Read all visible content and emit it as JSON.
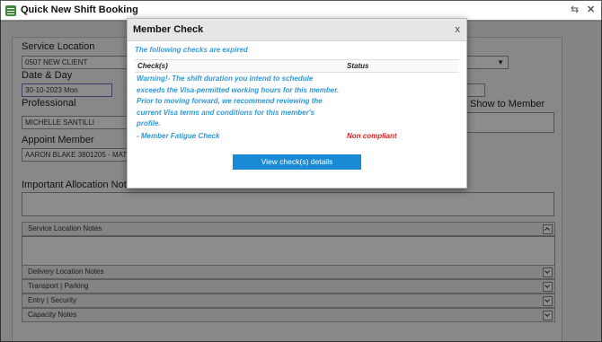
{
  "window": {
    "title": "Quick New Shift Booking"
  },
  "form": {
    "service_location": {
      "label": "Service Location",
      "value": "0507 NEW CLIENT"
    },
    "date_day": {
      "label": "Date & Day",
      "value": "30-10-2023 Mon"
    },
    "professional": {
      "label": "Professional",
      "value": "MICHELLE SANTILLI"
    },
    "show_to_member": {
      "label": "Show to Member"
    },
    "appoint_member": {
      "label": "Appoint Member",
      "value": "AARON BLAKE 3801205 - MATT:"
    },
    "important_notes": {
      "label": "Important Allocation Notes"
    },
    "sections": [
      {
        "label": "Service Location Notes"
      },
      {
        "label": "Delivery Location Notes"
      },
      {
        "label": "Transport | Parking"
      },
      {
        "label": "Entry | Security"
      },
      {
        "label": "Capacity Notes"
      }
    ]
  },
  "modal": {
    "title": "Member Check",
    "close_label": "x",
    "expired_note": "The following checks are expired",
    "columns": {
      "check": "Check(s)",
      "status": "Status"
    },
    "warning_lines": [
      "Warning!- The shift duration you intend to schedule",
      "exceeds the Visa-permitted working hours for this member.",
      "Prior to moving forward, we recommend reviewing the",
      "current Visa terms and conditions for this member's",
      "profile."
    ],
    "check_name": "- Member Fatigue Check",
    "check_status": "Non compliant",
    "button_label": "View check(s) details"
  },
  "colors": {
    "accent_blue": "#1a8ad6",
    "warning_text": "#2f97d6",
    "non_compliant": "#e02020"
  }
}
